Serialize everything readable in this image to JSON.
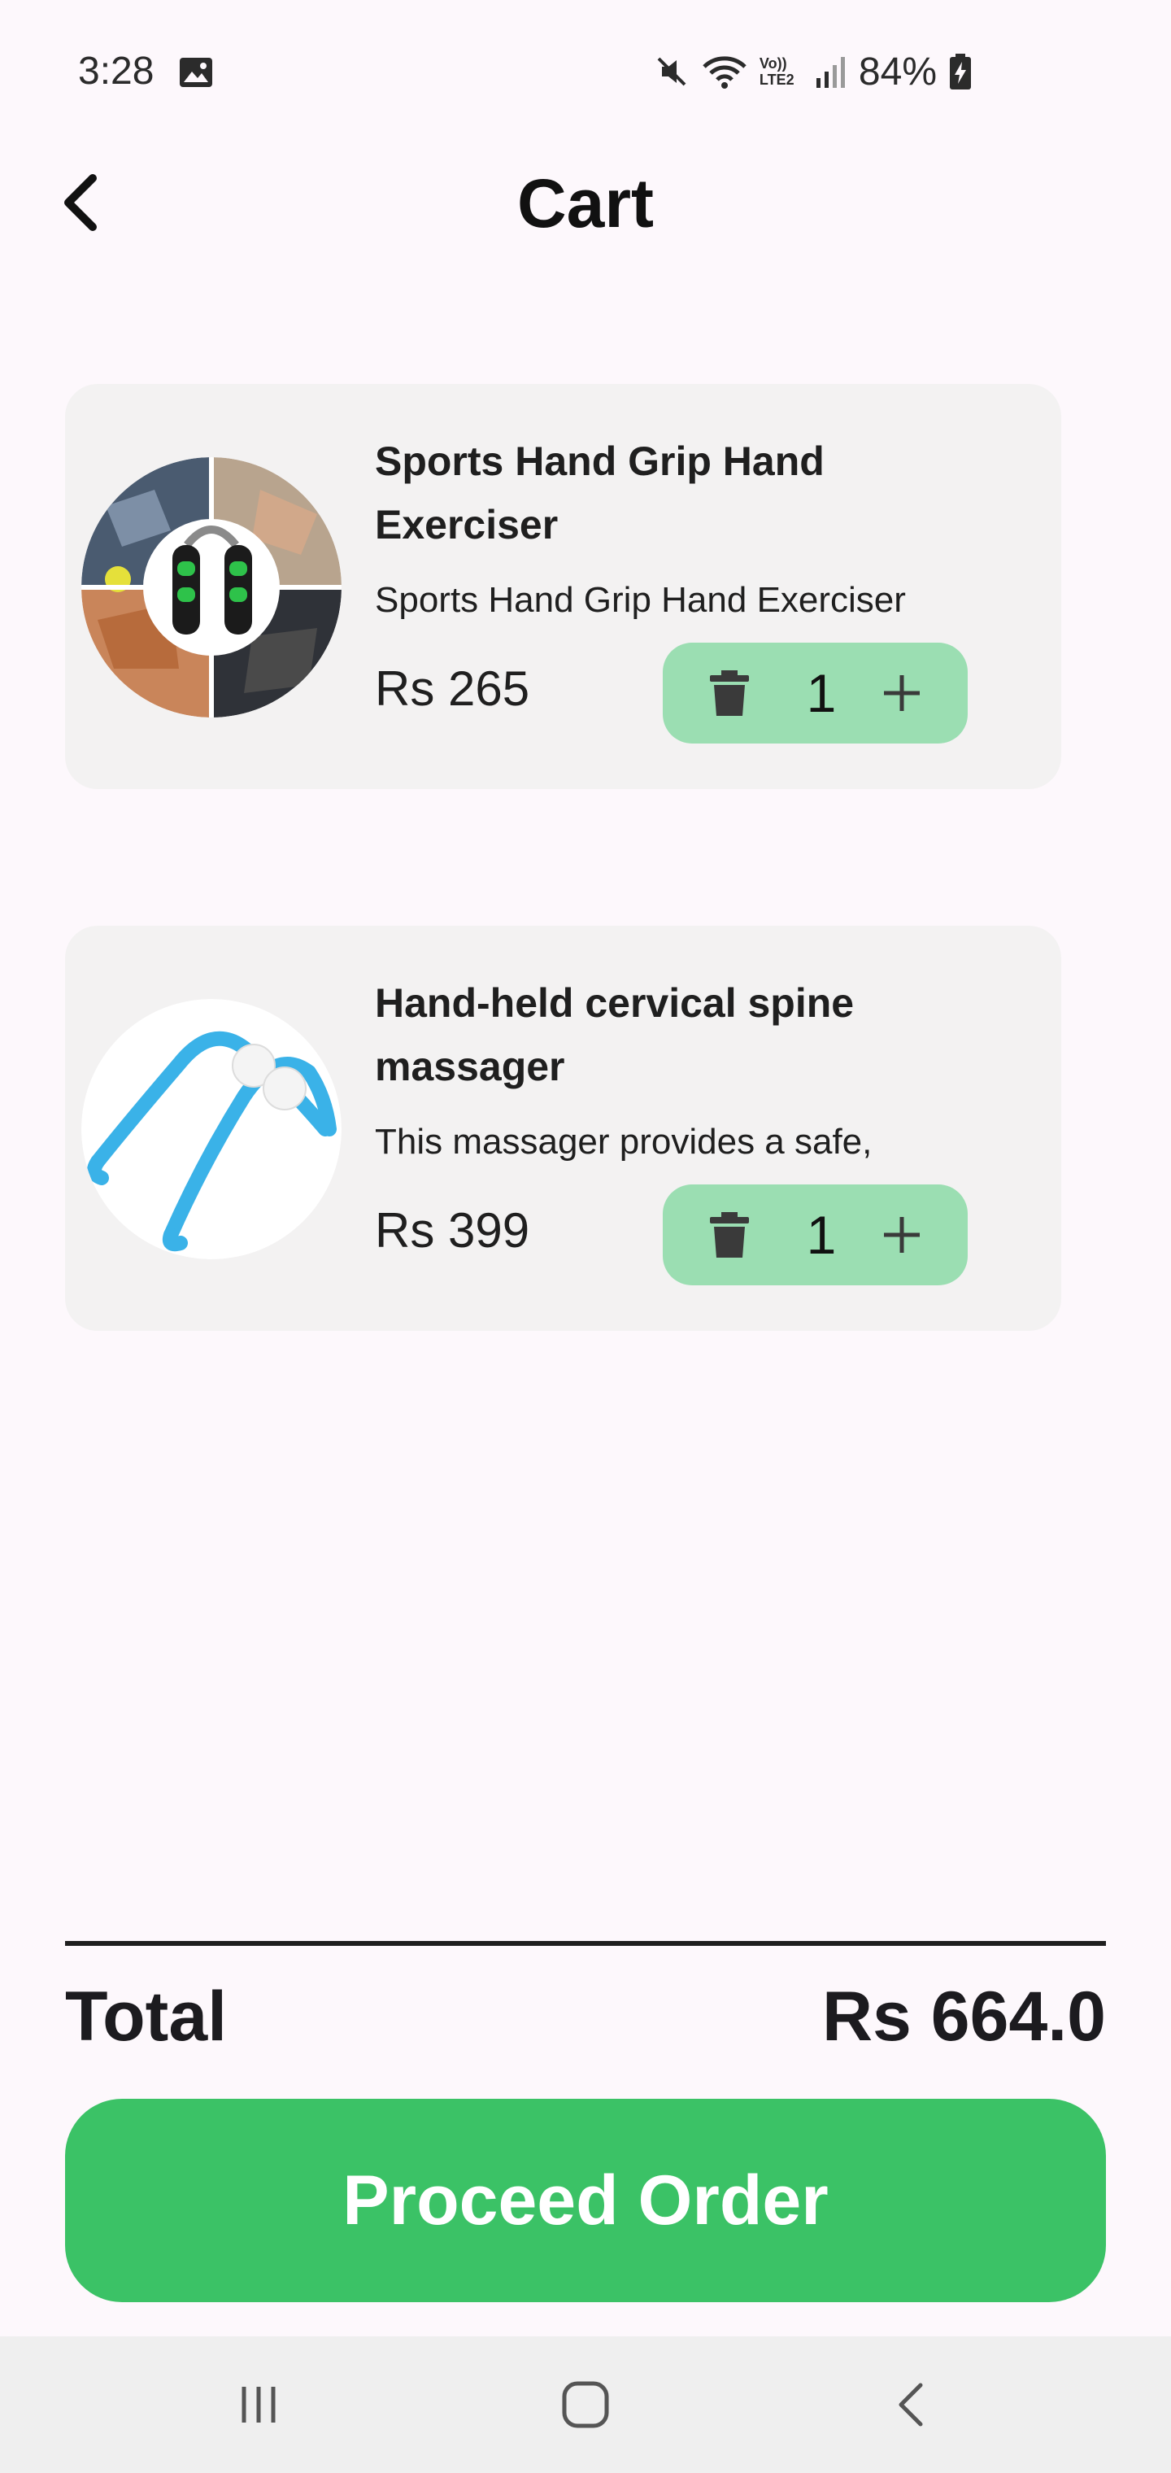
{
  "status_bar": {
    "time": "3:28",
    "gallery_icon": "image-icon",
    "mute_icon": "mute-icon",
    "wifi_icon": "wifi-icon",
    "volte_label": "Vo)) LTE2",
    "signal_icon": "signal-icon",
    "battery_percent": "84%",
    "battery_icon": "battery-charging-icon"
  },
  "header": {
    "back_icon": "chevron-left-icon",
    "title": "Cart"
  },
  "cart": {
    "items": [
      {
        "title": "Sports Hand Grip Hand Exerciser",
        "description": "Sports Hand Grip Hand Exerciser",
        "price": "Rs 265",
        "quantity": "1",
        "image": "hand-grip-exerciser-image"
      },
      {
        "title": "Hand-held cervical spine massager",
        "description": "This massager provides a safe,",
        "price": "Rs 399",
        "quantity": "1",
        "image": "cervical-massager-image"
      }
    ],
    "delete_icon": "trash-icon",
    "add_icon": "plus-icon"
  },
  "summary": {
    "total_label": "Total",
    "total_value": "Rs 664.0"
  },
  "actions": {
    "proceed_label": "Proceed Order"
  },
  "nav": {
    "recents_icon": "recents-icon",
    "home_icon": "home-icon",
    "back_icon": "back-icon"
  },
  "colors": {
    "background": "#fdf8fc",
    "card": "#f3f2f2",
    "quantity_pill": "#9bdeb2",
    "primary": "#3bc266",
    "nav_bar": "#efefef"
  }
}
